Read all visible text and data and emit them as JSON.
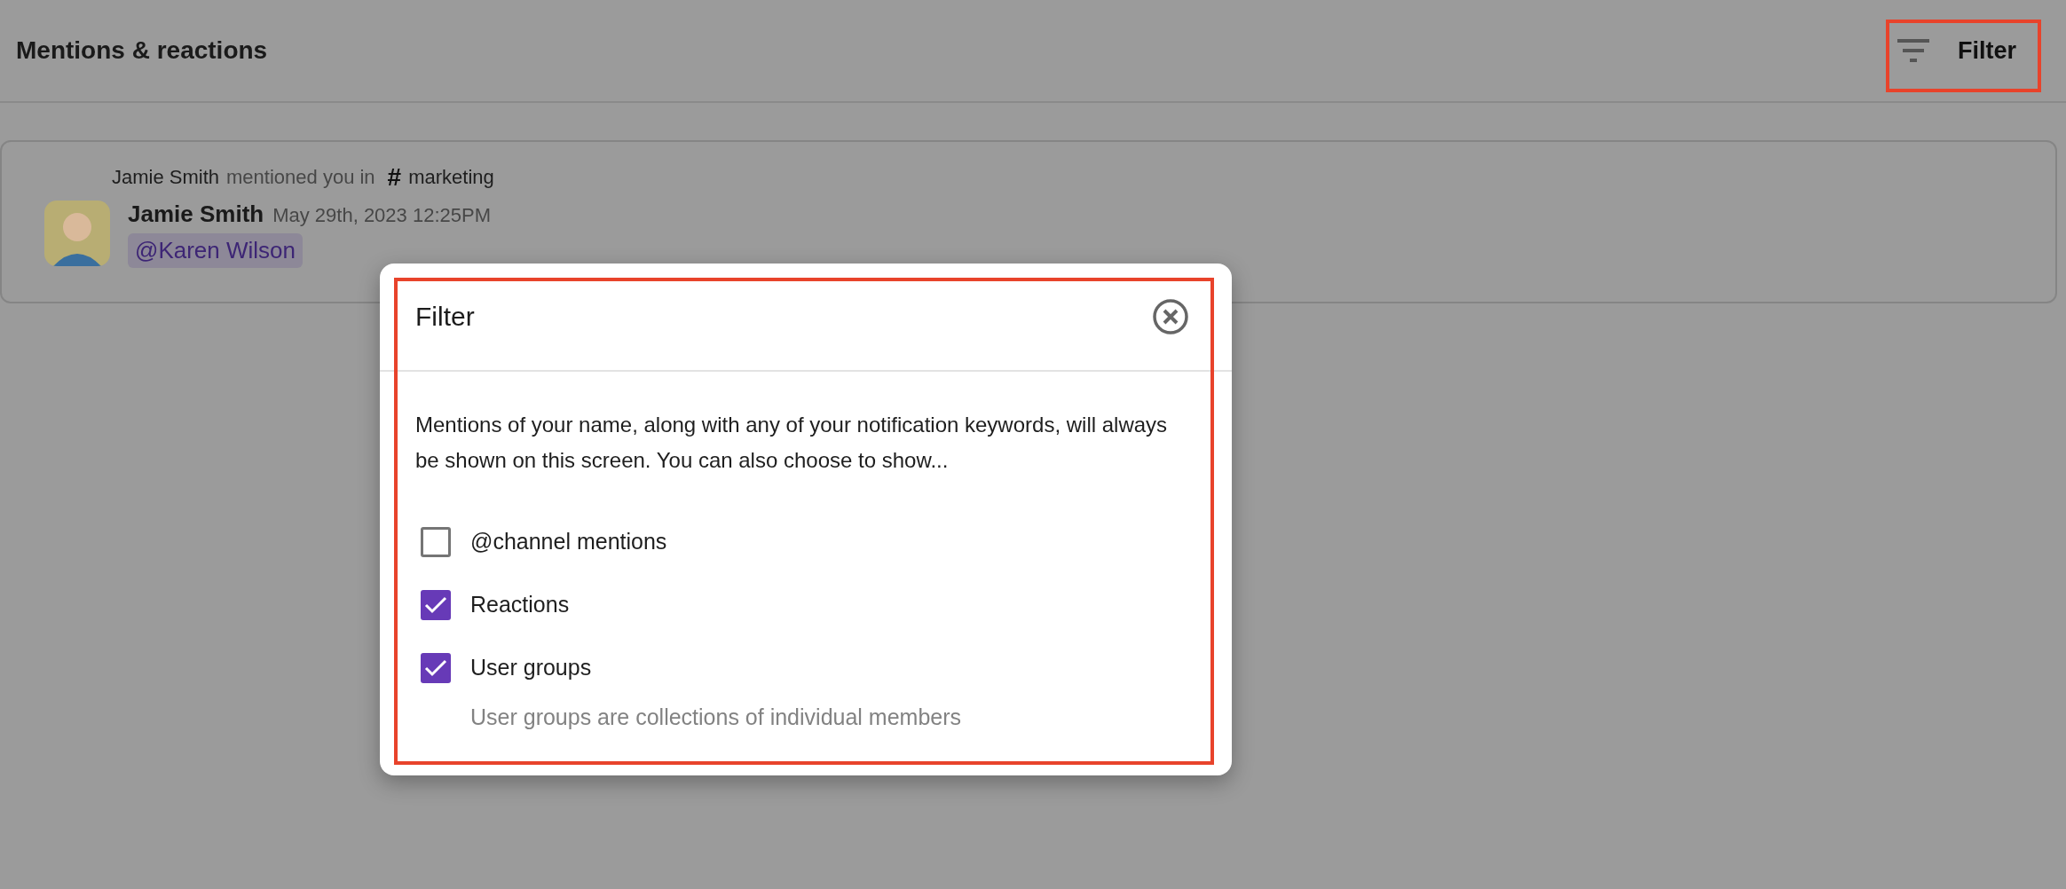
{
  "header": {
    "title": "Mentions & reactions",
    "filter_button": {
      "label": "Filter"
    }
  },
  "mentions": [
    {
      "author": "Jamie Smith",
      "action": "mentioned you in",
      "channel_symbol": "#",
      "channel": "marketing",
      "name": "Jamie Smith",
      "timestamp": "May 29th, 2023 12:25PM",
      "mention": "@Karen Wilson"
    }
  ],
  "dialog": {
    "title": "Filter",
    "description": "Mentions of your name, along with any of your notification keywords, will always be shown on this screen. You can also choose to show...",
    "options": [
      {
        "label": "@channel mentions",
        "checked": false
      },
      {
        "label": "Reactions",
        "checked": true
      },
      {
        "label": "User groups",
        "checked": true,
        "hint": "User groups are collections of individual members"
      }
    ]
  }
}
